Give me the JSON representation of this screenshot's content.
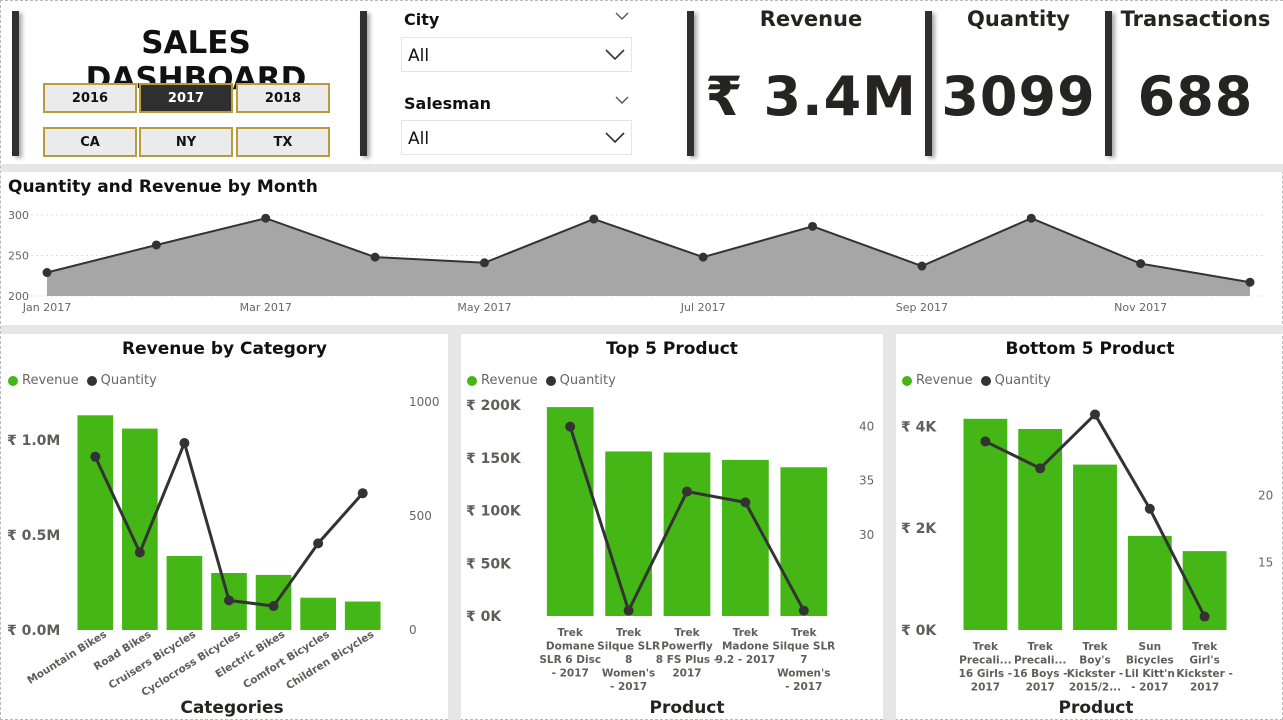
{
  "header": {
    "title": "SALES DASHBOARD",
    "year_buttons": [
      {
        "label": "2016",
        "active": false
      },
      {
        "label": "2017",
        "active": true
      },
      {
        "label": "2018",
        "active": false
      }
    ],
    "state_buttons": [
      {
        "label": "CA",
        "active": false
      },
      {
        "label": "NY",
        "active": false
      },
      {
        "label": "TX",
        "active": false
      }
    ],
    "city": {
      "label": "City",
      "value": "All"
    },
    "salesman": {
      "label": "Salesman",
      "value": "All"
    }
  },
  "kpis": {
    "revenue": {
      "label": "Revenue",
      "value": "₹ 3.4M"
    },
    "quantity": {
      "label": "Quantity",
      "value": "3099"
    },
    "transactions": {
      "label": "Transactions",
      "value": "688"
    }
  },
  "colors": {
    "bar": "#44b716",
    "line": "#333333",
    "area": "#a6a6a6",
    "accent_border": "#b79b3c"
  },
  "chart_data": [
    {
      "type": "area",
      "title": "Quantity and Revenue by Month",
      "x": [
        "Jan 2017",
        "Feb 2017",
        "Mar 2017",
        "Apr 2017",
        "May 2017",
        "Jun 2017",
        "Jul 2017",
        "Aug 2017",
        "Sep 2017",
        "Oct 2017",
        "Nov 2017",
        "Dec 2017"
      ],
      "x_tick_labels": [
        "Jan 2017",
        "Mar 2017",
        "May 2017",
        "Jul 2017",
        "Sep 2017",
        "Nov 2017"
      ],
      "values": [
        229,
        263,
        296,
        248,
        241,
        295,
        248,
        286,
        237,
        296,
        240,
        217
      ],
      "y_ticks": [
        "300",
        "250",
        "200"
      ],
      "ylim": [
        200,
        300
      ]
    },
    {
      "type": "bar",
      "title": "Revenue by Category",
      "xlabel": "Categories",
      "legend": [
        "Revenue",
        "Quantity"
      ],
      "categories": [
        "Mountain Bikes",
        "Road Bikes",
        "Cruisers Bicycles",
        "Cyclocross Bicycles",
        "Electric Bikes",
        "Comfort Bicycles",
        "Children Bicycles"
      ],
      "series": [
        {
          "name": "Revenue",
          "values": [
            1.13,
            1.06,
            0.39,
            0.3,
            0.29,
            0.17,
            0.15
          ],
          "unit": "M"
        },
        {
          "name": "Quantity",
          "values": [
            760,
            340,
            820,
            130,
            105,
            380,
            600
          ]
        }
      ],
      "y_ticks": [
        "₹ 1.0M",
        "₹ 0.5M",
        "₹ 0.0M"
      ],
      "y2_ticks": [
        "1000",
        "500",
        "0"
      ],
      "ylim": [
        0,
        1.2
      ],
      "y2lim": [
        0,
        1000
      ]
    },
    {
      "type": "bar",
      "title": "Top 5 Product",
      "xlabel": "Product",
      "legend": [
        "Revenue",
        "Quantity"
      ],
      "categories": [
        "Trek Domane SLR 6 Disc - 2017",
        "Trek Silque SLR 8 Women's - 2017",
        "Trek Powerfly 8 FS Plus - 2017",
        "Trek Madone 9.2 - 2017",
        "Trek Silque SLR 7 Women's - 2017"
      ],
      "category_lines": [
        [
          "Trek",
          "Domane",
          "SLR 6 Disc",
          "- 2017"
        ],
        [
          "Trek",
          "Silque SLR",
          "8",
          "Women's",
          "- 2017"
        ],
        [
          "Trek",
          "Powerfly",
          "8 FS Plus -",
          "2017"
        ],
        [
          "Trek",
          "Madone",
          "9.2 - 2017"
        ],
        [
          "Trek",
          "Silque SLR",
          "7",
          "Women's",
          "- 2017"
        ]
      ],
      "series": [
        {
          "name": "Revenue",
          "values": [
            198000,
            156000,
            155000,
            148000,
            141000
          ]
        },
        {
          "name": "Quantity",
          "values": [
            40,
            23,
            34,
            33,
            23
          ]
        }
      ],
      "y_ticks": [
        "₹ 200K",
        "₹ 150K",
        "₹ 100K",
        "₹ 50K",
        "₹ 0K"
      ],
      "y2_ticks": [
        "40",
        "35",
        "30"
      ],
      "ylim": [
        0,
        200000
      ],
      "y2lim": [
        22.5,
        42
      ]
    },
    {
      "type": "bar",
      "title": "Bottom 5 Product",
      "xlabel": "Product",
      "legend": [
        "Revenue",
        "Quantity"
      ],
      "categories": [
        "Trek Precali... 16 Girls - 2017",
        "Trek Precali... 16 Boys - 2017",
        "Trek Boy's Kickster - 2015/2...",
        "Sun Bicycles Lil Kitt'n - 2017",
        "Trek Girl's Kickster - 2017"
      ],
      "category_lines": [
        [
          "Trek",
          "Precali...",
          "16 Girls -",
          "2017"
        ],
        [
          "Trek",
          "Precali...",
          "16 Boys -",
          "2017"
        ],
        [
          "Trek",
          "Boy's",
          "Kickster -",
          "2015/2..."
        ],
        [
          "Sun",
          "Bicycles",
          "Lil Kitt'n",
          "- 2017"
        ],
        [
          "Trek",
          "Girl's",
          "Kickster -",
          "2017"
        ]
      ],
      "series": [
        {
          "name": "Revenue",
          "values": [
            4150,
            3950,
            3250,
            1850,
            1550
          ]
        },
        {
          "name": "Quantity",
          "values": [
            24,
            22,
            26,
            19,
            11
          ]
        }
      ],
      "y_ticks": [
        "₹ 4K",
        "₹ 2K",
        "₹ 0K"
      ],
      "y2_ticks": [
        "20",
        "15"
      ],
      "ylim": [
        0,
        4500
      ],
      "y2lim": [
        10,
        27
      ]
    }
  ]
}
